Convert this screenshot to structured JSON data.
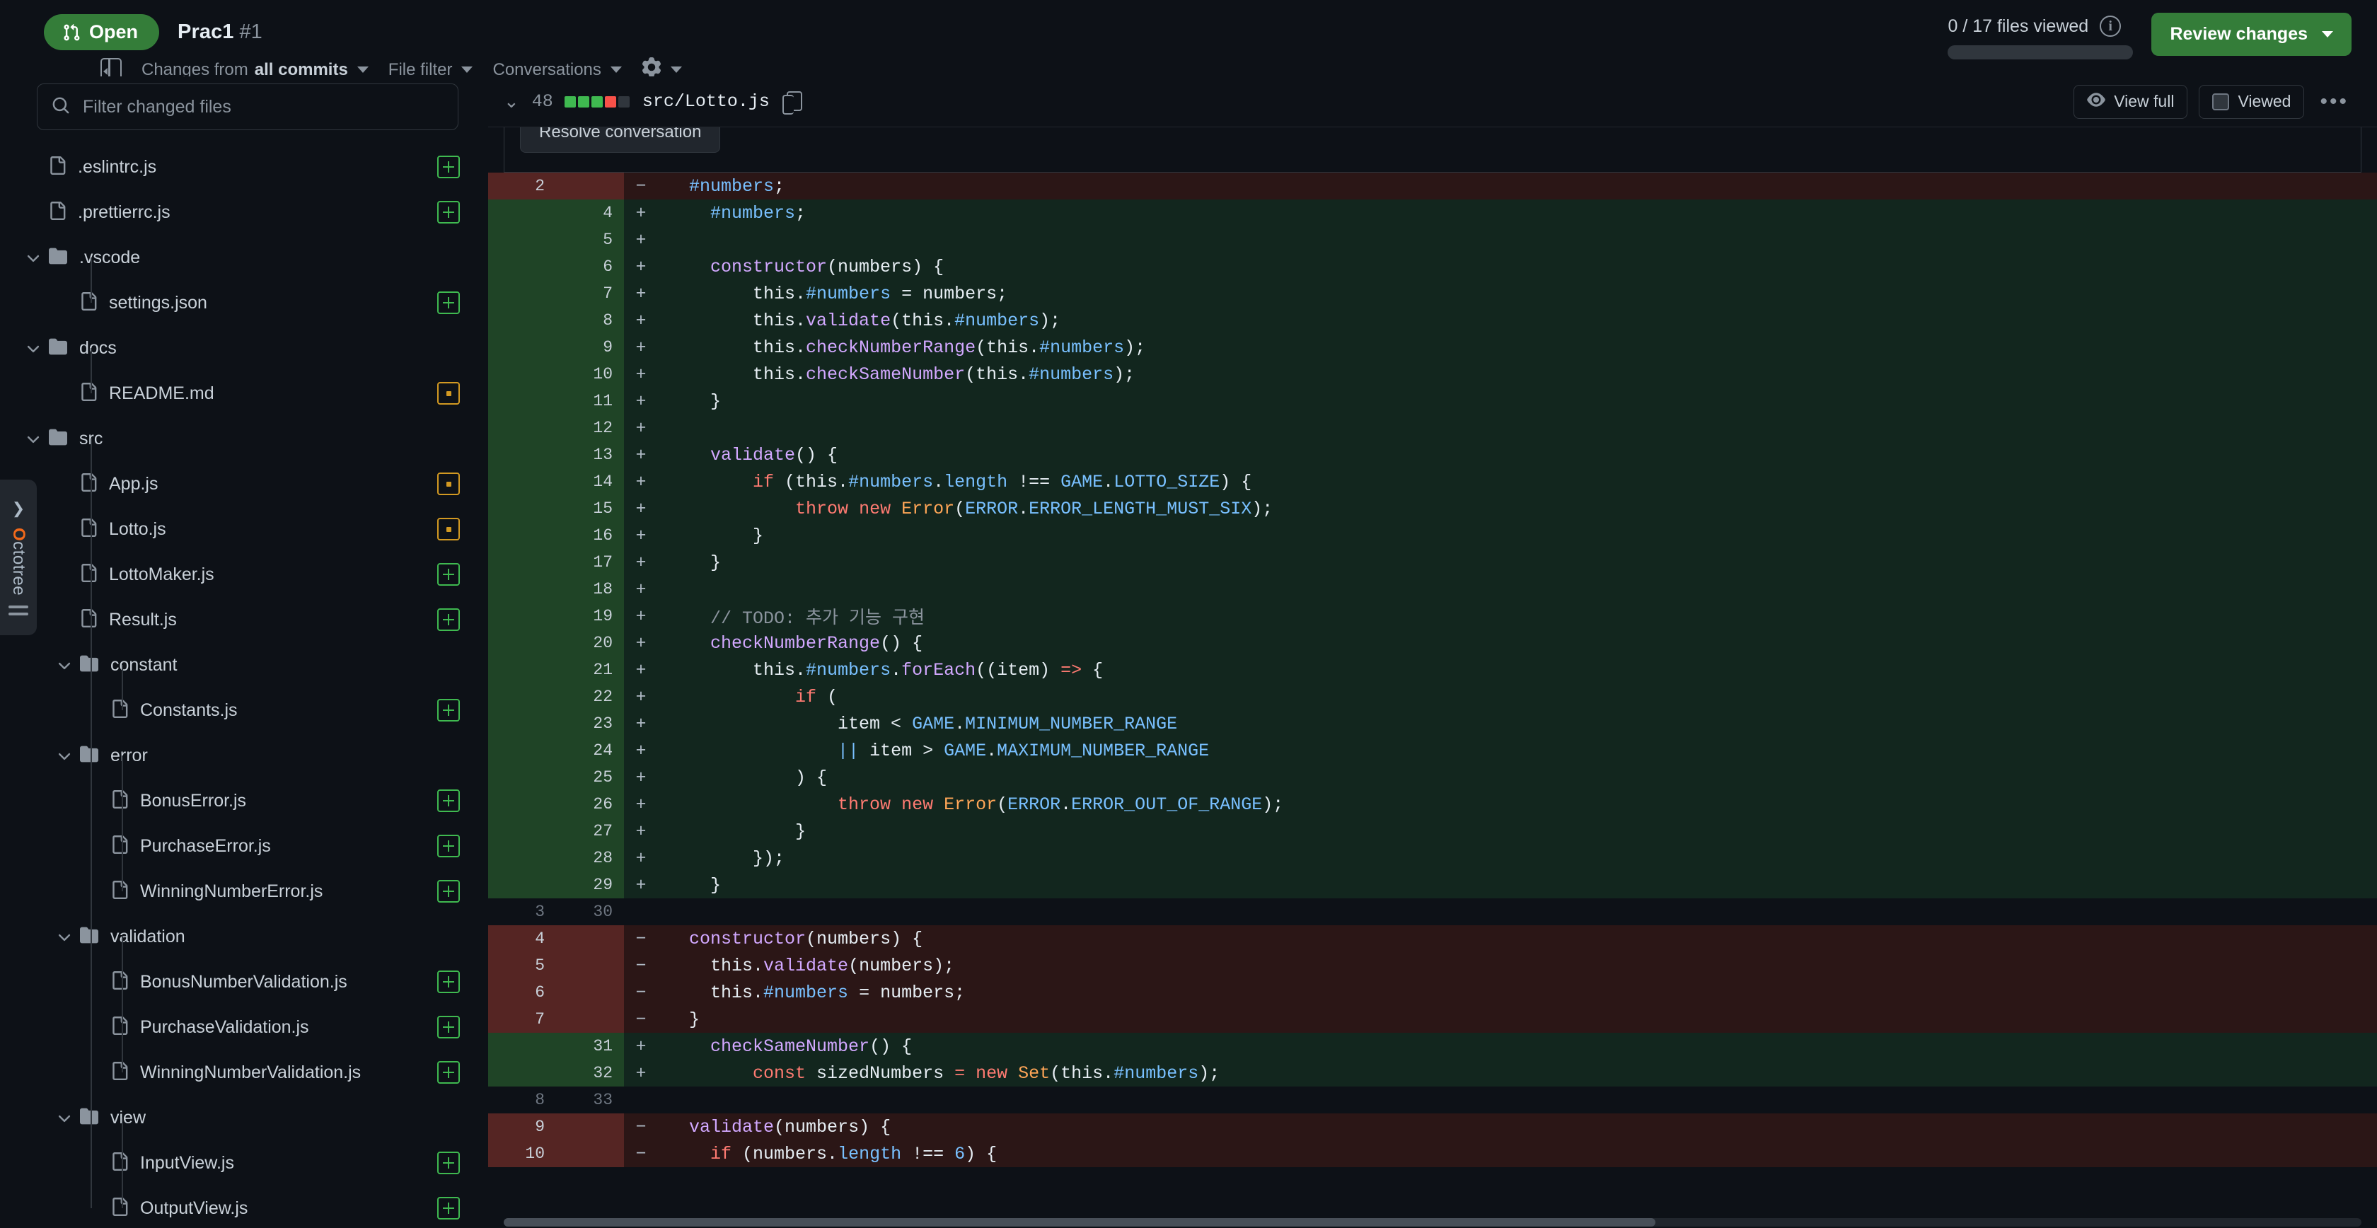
{
  "header": {
    "state_label": "Open",
    "pr_title": "Prac1",
    "pr_number": "#1",
    "changes_from_prefix": "Changes from ",
    "changes_from_value": "all commits",
    "file_filter_label": "File filter",
    "conversations_label": "Conversations",
    "gear_icon": "gear-icon",
    "files_viewed_text": "0 / 17 files viewed",
    "info_icon": "i",
    "progress_percent": 0,
    "review_changes_label": "Review changes",
    "accent_green": "#347d39"
  },
  "sidebar": {
    "filter_placeholder": "Filter changed files",
    "filter_value": "",
    "octotree": {
      "label": "Octotree",
      "brand_color": "#f2691b"
    },
    "tree": [
      {
        "type": "file",
        "depth": 0,
        "label": ".eslintrc.js",
        "status": "added"
      },
      {
        "type": "file",
        "depth": 0,
        "label": ".prettierrc.js",
        "status": "added"
      },
      {
        "type": "folder",
        "depth": 0,
        "label": ".vscode",
        "status": "none"
      },
      {
        "type": "file",
        "depth": 1,
        "label": "settings.json",
        "status": "added"
      },
      {
        "type": "folder",
        "depth": 0,
        "label": "docs",
        "status": "none"
      },
      {
        "type": "file",
        "depth": 1,
        "label": "README.md",
        "status": "modified"
      },
      {
        "type": "folder",
        "depth": 0,
        "label": "src",
        "status": "none"
      },
      {
        "type": "file",
        "depth": 1,
        "label": "App.js",
        "status": "modified"
      },
      {
        "type": "file",
        "depth": 1,
        "label": "Lotto.js",
        "status": "modified"
      },
      {
        "type": "file",
        "depth": 1,
        "label": "LottoMaker.js",
        "status": "added"
      },
      {
        "type": "file",
        "depth": 1,
        "label": "Result.js",
        "status": "added"
      },
      {
        "type": "folder",
        "depth": 1,
        "label": "constant",
        "status": "none"
      },
      {
        "type": "file",
        "depth": 2,
        "label": "Constants.js",
        "status": "added"
      },
      {
        "type": "folder",
        "depth": 1,
        "label": "error",
        "status": "none"
      },
      {
        "type": "file",
        "depth": 2,
        "label": "BonusError.js",
        "status": "added"
      },
      {
        "type": "file",
        "depth": 2,
        "label": "PurchaseError.js",
        "status": "added"
      },
      {
        "type": "file",
        "depth": 2,
        "label": "WinningNumberError.js",
        "status": "added"
      },
      {
        "type": "folder",
        "depth": 1,
        "label": "validation",
        "status": "none"
      },
      {
        "type": "file",
        "depth": 2,
        "label": "BonusNumberValidation.js",
        "status": "added"
      },
      {
        "type": "file",
        "depth": 2,
        "label": "PurchaseValidation.js",
        "status": "added"
      },
      {
        "type": "file",
        "depth": 2,
        "label": "WinningNumberValidation.js",
        "status": "added"
      },
      {
        "type": "folder",
        "depth": 1,
        "label": "view",
        "status": "none"
      },
      {
        "type": "file",
        "depth": 2,
        "label": "InputView.js",
        "status": "added"
      },
      {
        "type": "file",
        "depth": 2,
        "label": "OutputView.js",
        "status": "added"
      }
    ]
  },
  "file_header": {
    "change_count": "48",
    "path": "src/Lotto.js",
    "diffstat": [
      "#3fb950",
      "#3fb950",
      "#3fb950",
      "#f85149",
      "#30363d"
    ],
    "view_full_label": "View full",
    "viewed_label": "Viewed",
    "kebab_label": "•••"
  },
  "comment_strip": {
    "resolve_label": "Resolve conversation"
  },
  "diff": {
    "rows": [
      {
        "kind": "del",
        "old": "2",
        "new": "",
        "sign": "−",
        "tokens": [
          {
            "t": "  ",
            "c": "pln"
          },
          {
            "t": "#numbers",
            "c": "prop"
          },
          {
            "t": ";",
            "c": "pln"
          }
        ]
      },
      {
        "kind": "add",
        "old": "",
        "new": "4",
        "sign": "+",
        "tokens": [
          {
            "t": "    ",
            "c": "pln"
          },
          {
            "t": "#numbers",
            "c": "prop"
          },
          {
            "t": ";",
            "c": "pln"
          }
        ]
      },
      {
        "kind": "add",
        "old": "",
        "new": "5",
        "sign": "+",
        "tokens": []
      },
      {
        "kind": "add",
        "old": "",
        "new": "6",
        "sign": "+",
        "tokens": [
          {
            "t": "    ",
            "c": "pln"
          },
          {
            "t": "constructor",
            "c": "fn"
          },
          {
            "t": "(numbers) {",
            "c": "pln"
          }
        ]
      },
      {
        "kind": "add",
        "old": "",
        "new": "7",
        "sign": "+",
        "tokens": [
          {
            "t": "        this.",
            "c": "pln"
          },
          {
            "t": "#numbers",
            "c": "prop"
          },
          {
            "t": " = numbers;",
            "c": "pln"
          }
        ]
      },
      {
        "kind": "add",
        "old": "",
        "new": "8",
        "sign": "+",
        "tokens": [
          {
            "t": "        this.",
            "c": "pln"
          },
          {
            "t": "validate",
            "c": "fn"
          },
          {
            "t": "(this.",
            "c": "pln"
          },
          {
            "t": "#numbers",
            "c": "prop"
          },
          {
            "t": ");",
            "c": "pln"
          }
        ]
      },
      {
        "kind": "add",
        "old": "",
        "new": "9",
        "sign": "+",
        "tokens": [
          {
            "t": "        this.",
            "c": "pln"
          },
          {
            "t": "checkNumberRange",
            "c": "fn"
          },
          {
            "t": "(this.",
            "c": "pln"
          },
          {
            "t": "#numbers",
            "c": "prop"
          },
          {
            "t": ");",
            "c": "pln"
          }
        ]
      },
      {
        "kind": "add",
        "old": "",
        "new": "10",
        "sign": "+",
        "tokens": [
          {
            "t": "        this.",
            "c": "pln"
          },
          {
            "t": "checkSameNumber",
            "c": "fn"
          },
          {
            "t": "(this.",
            "c": "pln"
          },
          {
            "t": "#numbers",
            "c": "prop"
          },
          {
            "t": ");",
            "c": "pln"
          }
        ]
      },
      {
        "kind": "add",
        "old": "",
        "new": "11",
        "sign": "+",
        "tokens": [
          {
            "t": "    }",
            "c": "pln"
          }
        ]
      },
      {
        "kind": "add",
        "old": "",
        "new": "12",
        "sign": "+",
        "tokens": []
      },
      {
        "kind": "add",
        "old": "",
        "new": "13",
        "sign": "+",
        "tokens": [
          {
            "t": "    ",
            "c": "pln"
          },
          {
            "t": "validate",
            "c": "fn"
          },
          {
            "t": "() {",
            "c": "pln"
          }
        ]
      },
      {
        "kind": "add",
        "old": "",
        "new": "14",
        "sign": "+",
        "tokens": [
          {
            "t": "        ",
            "c": "pln"
          },
          {
            "t": "if",
            "c": "kw"
          },
          {
            "t": " (this.",
            "c": "pln"
          },
          {
            "t": "#numbers",
            "c": "prop"
          },
          {
            "t": ".",
            "c": "pln"
          },
          {
            "t": "length",
            "c": "prop"
          },
          {
            "t": " !== ",
            "c": "pln"
          },
          {
            "t": "GAME",
            "c": "prop"
          },
          {
            "t": ".",
            "c": "pln"
          },
          {
            "t": "LOTTO_SIZE",
            "c": "prop"
          },
          {
            "t": ") {",
            "c": "pln"
          }
        ]
      },
      {
        "kind": "add",
        "old": "",
        "new": "15",
        "sign": "+",
        "tokens": [
          {
            "t": "            ",
            "c": "pln"
          },
          {
            "t": "throw",
            "c": "kw"
          },
          {
            "t": " ",
            "c": "pln"
          },
          {
            "t": "new",
            "c": "kw"
          },
          {
            "t": " ",
            "c": "pln"
          },
          {
            "t": "Error",
            "c": "cls"
          },
          {
            "t": "(",
            "c": "pln"
          },
          {
            "t": "ERROR",
            "c": "prop"
          },
          {
            "t": ".",
            "c": "pln"
          },
          {
            "t": "ERROR_LENGTH_MUST_SIX",
            "c": "prop"
          },
          {
            "t": ");",
            "c": "pln"
          }
        ]
      },
      {
        "kind": "add",
        "old": "",
        "new": "16",
        "sign": "+",
        "tokens": [
          {
            "t": "        }",
            "c": "pln"
          }
        ]
      },
      {
        "kind": "add",
        "old": "",
        "new": "17",
        "sign": "+",
        "tokens": [
          {
            "t": "    }",
            "c": "pln"
          }
        ]
      },
      {
        "kind": "add",
        "old": "",
        "new": "18",
        "sign": "+",
        "tokens": []
      },
      {
        "kind": "add",
        "old": "",
        "new": "19",
        "sign": "+",
        "tokens": [
          {
            "t": "    ",
            "c": "pln"
          },
          {
            "t": "// TODO: 추가 기능 구현",
            "c": "com"
          }
        ]
      },
      {
        "kind": "add",
        "old": "",
        "new": "20",
        "sign": "+",
        "tokens": [
          {
            "t": "    ",
            "c": "pln"
          },
          {
            "t": "checkNumberRange",
            "c": "fn"
          },
          {
            "t": "() {",
            "c": "pln"
          }
        ]
      },
      {
        "kind": "add",
        "old": "",
        "new": "21",
        "sign": "+",
        "tokens": [
          {
            "t": "        this.",
            "c": "pln"
          },
          {
            "t": "#numbers",
            "c": "prop"
          },
          {
            "t": ".",
            "c": "pln"
          },
          {
            "t": "forEach",
            "c": "fn"
          },
          {
            "t": "((item) ",
            "c": "pln"
          },
          {
            "t": "=>",
            "c": "kw"
          },
          {
            "t": " {",
            "c": "pln"
          }
        ]
      },
      {
        "kind": "add",
        "old": "",
        "new": "22",
        "sign": "+",
        "tokens": [
          {
            "t": "            ",
            "c": "pln"
          },
          {
            "t": "if",
            "c": "kw"
          },
          {
            "t": " (",
            "c": "pln"
          }
        ]
      },
      {
        "kind": "add",
        "old": "",
        "new": "23",
        "sign": "+",
        "tokens": [
          {
            "t": "                item < ",
            "c": "pln"
          },
          {
            "t": "GAME",
            "c": "prop"
          },
          {
            "t": ".",
            "c": "pln"
          },
          {
            "t": "MINIMUM_NUMBER_RANGE",
            "c": "prop"
          }
        ]
      },
      {
        "kind": "add",
        "old": "",
        "new": "24",
        "sign": "+",
        "tokens": [
          {
            "t": "                ",
            "c": "pln"
          },
          {
            "t": "||",
            "c": "prop"
          },
          {
            "t": " item > ",
            "c": "pln"
          },
          {
            "t": "GAME",
            "c": "prop"
          },
          {
            "t": ".",
            "c": "pln"
          },
          {
            "t": "MAXIMUM_NUMBER_RANGE",
            "c": "prop"
          }
        ]
      },
      {
        "kind": "add",
        "old": "",
        "new": "25",
        "sign": "+",
        "tokens": [
          {
            "t": "            ) {",
            "c": "pln"
          }
        ]
      },
      {
        "kind": "add",
        "old": "",
        "new": "26",
        "sign": "+",
        "tokens": [
          {
            "t": "                ",
            "c": "pln"
          },
          {
            "t": "throw",
            "c": "kw"
          },
          {
            "t": " ",
            "c": "pln"
          },
          {
            "t": "new",
            "c": "kw"
          },
          {
            "t": " ",
            "c": "pln"
          },
          {
            "t": "Error",
            "c": "cls"
          },
          {
            "t": "(",
            "c": "pln"
          },
          {
            "t": "ERROR",
            "c": "prop"
          },
          {
            "t": ".",
            "c": "pln"
          },
          {
            "t": "ERROR_OUT_OF_RANGE",
            "c": "prop"
          },
          {
            "t": ");",
            "c": "pln"
          }
        ]
      },
      {
        "kind": "add",
        "old": "",
        "new": "27",
        "sign": "+",
        "tokens": [
          {
            "t": "            }",
            "c": "pln"
          }
        ]
      },
      {
        "kind": "add",
        "old": "",
        "new": "28",
        "sign": "+",
        "tokens": [
          {
            "t": "        });",
            "c": "pln"
          }
        ]
      },
      {
        "kind": "add",
        "old": "",
        "new": "29",
        "sign": "+",
        "tokens": [
          {
            "t": "    }",
            "c": "pln"
          }
        ]
      },
      {
        "kind": "ctx",
        "old": "3",
        "new": "30",
        "sign": "",
        "tokens": []
      },
      {
        "kind": "del",
        "old": "4",
        "new": "",
        "sign": "−",
        "tokens": [
          {
            "t": "  ",
            "c": "pln"
          },
          {
            "t": "constructor",
            "c": "fn"
          },
          {
            "t": "(numbers) {",
            "c": "pln"
          }
        ]
      },
      {
        "kind": "del",
        "old": "5",
        "new": "",
        "sign": "−",
        "tokens": [
          {
            "t": "    this.",
            "c": "pln"
          },
          {
            "t": "validate",
            "c": "fn"
          },
          {
            "t": "(numbers);",
            "c": "pln"
          }
        ]
      },
      {
        "kind": "del",
        "old": "6",
        "new": "",
        "sign": "−",
        "tokens": [
          {
            "t": "    this.",
            "c": "pln"
          },
          {
            "t": "#numbers",
            "c": "prop"
          },
          {
            "t": " = numbers;",
            "c": "pln"
          }
        ]
      },
      {
        "kind": "del",
        "old": "7",
        "new": "",
        "sign": "−",
        "tokens": [
          {
            "t": "  }",
            "c": "pln"
          }
        ]
      },
      {
        "kind": "add",
        "old": "",
        "new": "31",
        "sign": "+",
        "tokens": [
          {
            "t": "    ",
            "c": "pln"
          },
          {
            "t": "checkSameNumber",
            "c": "fn"
          },
          {
            "t": "() {",
            "c": "pln"
          }
        ]
      },
      {
        "kind": "add",
        "old": "",
        "new": "32",
        "sign": "+",
        "tokens": [
          {
            "t": "        ",
            "c": "pln"
          },
          {
            "t": "const",
            "c": "kw"
          },
          {
            "t": " sizedNumbers ",
            "c": "pln"
          },
          {
            "t": "=",
            "c": "kw"
          },
          {
            "t": " ",
            "c": "pln"
          },
          {
            "t": "new",
            "c": "kw"
          },
          {
            "t": " ",
            "c": "pln"
          },
          {
            "t": "Set",
            "c": "cls"
          },
          {
            "t": "(this.",
            "c": "pln"
          },
          {
            "t": "#numbers",
            "c": "prop"
          },
          {
            "t": ");",
            "c": "pln"
          }
        ]
      },
      {
        "kind": "ctx",
        "old": "8",
        "new": "33",
        "sign": "",
        "tokens": []
      },
      {
        "kind": "del",
        "old": "9",
        "new": "",
        "sign": "−",
        "tokens": [
          {
            "t": "  ",
            "c": "pln"
          },
          {
            "t": "validate",
            "c": "fn"
          },
          {
            "t": "(numbers) {",
            "c": "pln"
          }
        ]
      },
      {
        "kind": "del",
        "old": "10",
        "new": "",
        "sign": "−",
        "tokens": [
          {
            "t": "    ",
            "c": "pln"
          },
          {
            "t": "if",
            "c": "kw"
          },
          {
            "t": " (numbers.",
            "c": "pln"
          },
          {
            "t": "length",
            "c": "prop"
          },
          {
            "t": " !== ",
            "c": "pln"
          },
          {
            "t": "6",
            "c": "prop"
          },
          {
            "t": ") {",
            "c": "pln"
          }
        ]
      }
    ]
  }
}
